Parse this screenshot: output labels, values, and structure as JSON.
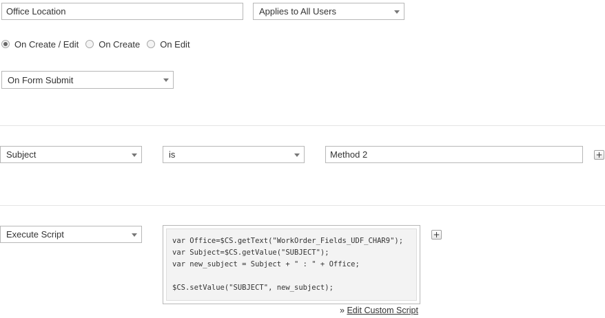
{
  "field": {
    "name_value": "Office Location",
    "applies_to": "Applies to All Users"
  },
  "trigger_modes": [
    {
      "label": "On Create / Edit",
      "checked": true
    },
    {
      "label": "On Create",
      "checked": false
    },
    {
      "label": "On Edit",
      "checked": false
    }
  ],
  "event_select": "On Form Submit",
  "condition": {
    "field": "Subject",
    "operator": "is",
    "value": "Method 2",
    "add_label": "+"
  },
  "action": {
    "type": "Execute Script",
    "script": "var Office=$CS.getText(\"WorkOrder_Fields_UDF_CHAR9\");\nvar Subject=$CS.getValue(\"SUBJECT\");\nvar new_subject = Subject + \" : \" + Office;\n\n$CS.setValue(\"SUBJECT\", new_subject);",
    "add_label": "+",
    "edit_prefix": "» ",
    "edit_link": "Edit Custom Script"
  }
}
